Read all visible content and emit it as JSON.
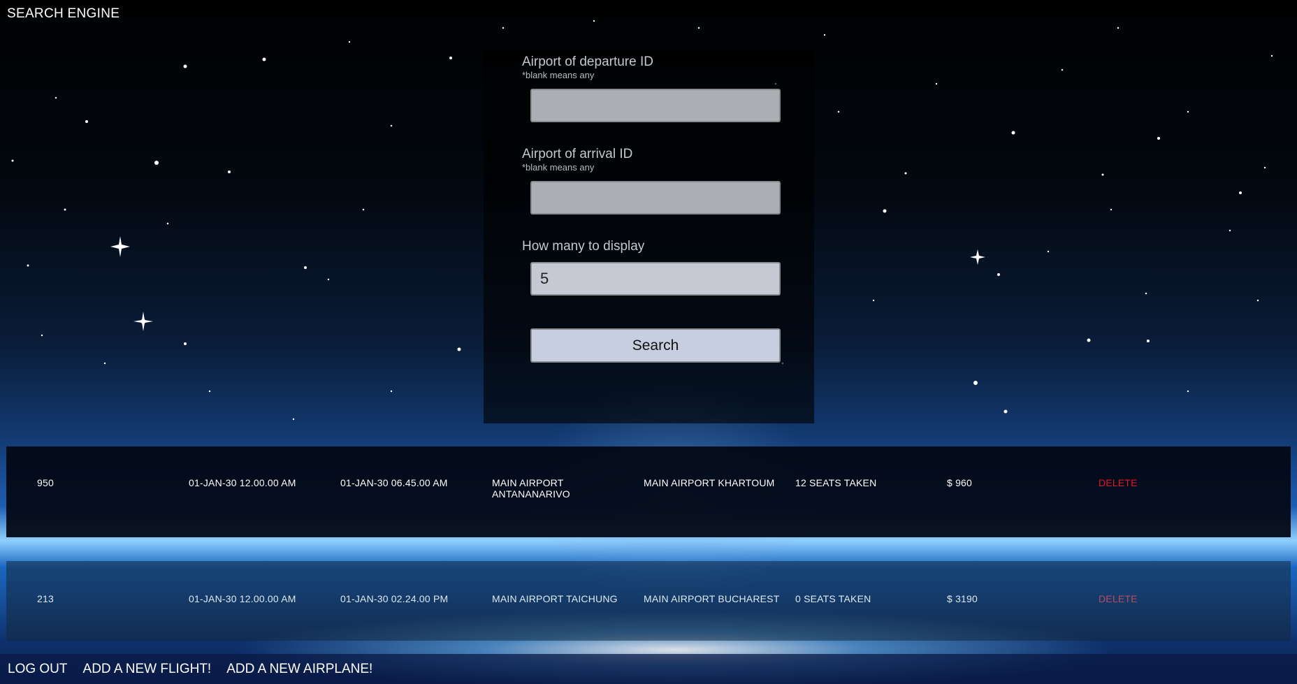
{
  "page": {
    "title": "SEARCH ENGINE"
  },
  "search_form": {
    "departure": {
      "label": "Airport of departure ID",
      "hint": "*blank means any",
      "value": ""
    },
    "arrival": {
      "label": "Airport of arrival ID",
      "hint": "*blank means any",
      "value": ""
    },
    "display_count": {
      "label": "How many to display",
      "value": "5"
    },
    "search_button": "Search"
  },
  "results": [
    {
      "id": "950",
      "departure_time": "01-JAN-30 12.00.00 AM",
      "arrival_time": "01-JAN-30 06.45.00 AM",
      "from": "MAIN AIRPORT ANTANANARIVO",
      "to": "MAIN AIRPORT KHARTOUM",
      "seats": "12 SEATS TAKEN",
      "price": "$ 960",
      "action": "DELETE"
    },
    {
      "id": "213",
      "departure_time": "01-JAN-30 12.00.00 AM",
      "arrival_time": "01-JAN-30 02.24.00 PM",
      "from": "MAIN AIRPORT TAICHUNG",
      "to": "MAIN AIRPORT BUCHAREST",
      "seats": "0 SEATS TAKEN",
      "price": "$ 3190",
      "action": "DELETE"
    }
  ],
  "footer": {
    "logout": "LOG OUT",
    "add_flight": "ADD A NEW FLIGHT!",
    "add_airplane": "ADD A NEW AIRPLANE!"
  },
  "colors": {
    "delete": "#e3142a",
    "sky_top": "#000000",
    "horizon_glow": "#8fd0ff"
  }
}
